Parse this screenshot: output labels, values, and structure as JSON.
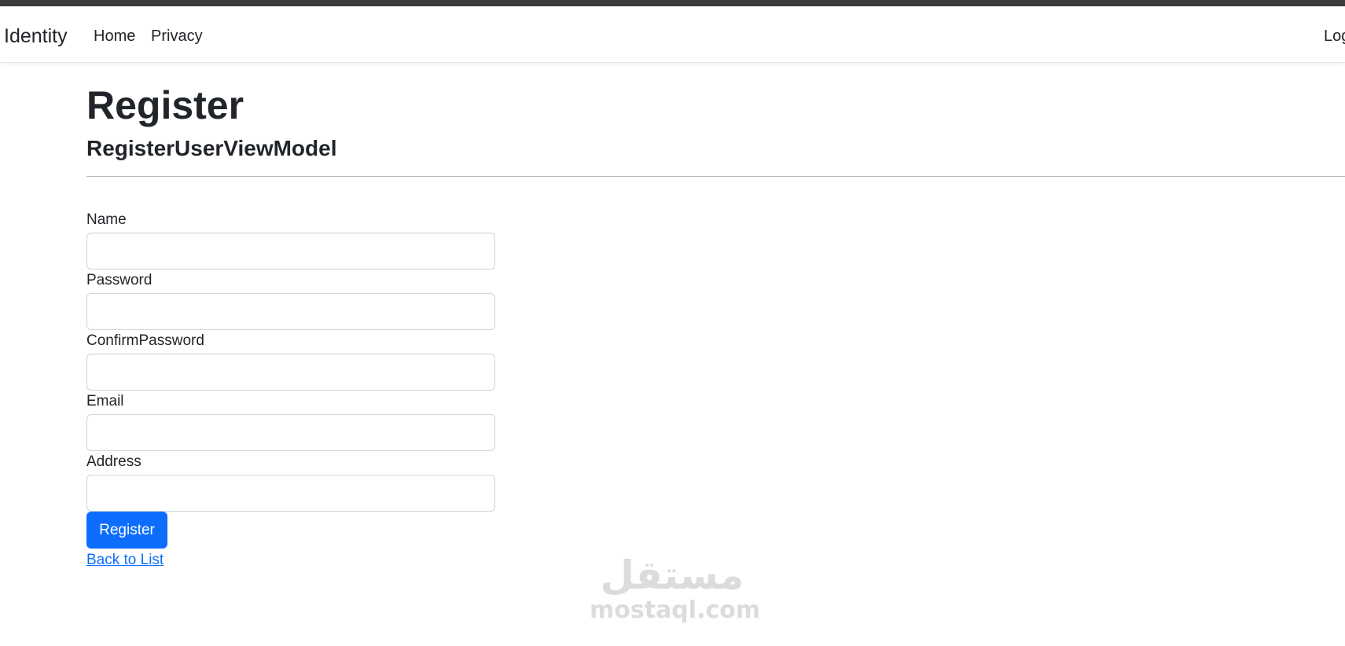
{
  "navbar": {
    "brand": "Identity",
    "links": [
      "Home",
      "Privacy"
    ],
    "login_label": "Log"
  },
  "page": {
    "title": "Register",
    "subtitle": "RegisterUserViewModel"
  },
  "form": {
    "fields": [
      {
        "label": "Name",
        "value": ""
      },
      {
        "label": "Password",
        "value": ""
      },
      {
        "label": "ConfirmPassword",
        "value": ""
      },
      {
        "label": "Email",
        "value": ""
      },
      {
        "label": "Address",
        "value": ""
      }
    ],
    "submit_label": "Register",
    "back_link": "Back to List"
  },
  "watermark": {
    "arabic": "مستقل",
    "latin": "mostaql.com"
  },
  "colors": {
    "primary": "#0d6efd",
    "text": "#212529",
    "input_border": "#ced4da"
  }
}
